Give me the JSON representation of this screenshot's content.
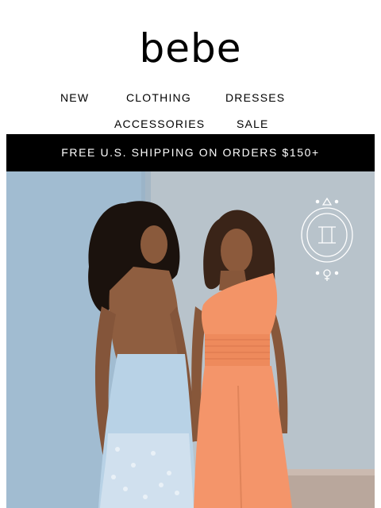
{
  "brand": {
    "logo_text": "bebe"
  },
  "nav": {
    "items": [
      {
        "label": "NEW"
      },
      {
        "label": "CLOTHING"
      },
      {
        "label": "DRESSES"
      },
      {
        "label": "ACCESSORIES"
      },
      {
        "label": "SALE"
      }
    ]
  },
  "promo_banner": {
    "text": "FREE U.S. SHIPPING ON ORDERS $150+"
  },
  "hero": {
    "image_subject": "two models in blue lace halter dress and orange one-shoulder jumpsuit",
    "zodiac_badge": "gemini-zodiac-icon",
    "colors": {
      "left_wall": "#a3bdd2",
      "right_wall": "#b9c4cc",
      "jumpsuit": "#f4956a",
      "dress": "#b9d3e6"
    }
  }
}
